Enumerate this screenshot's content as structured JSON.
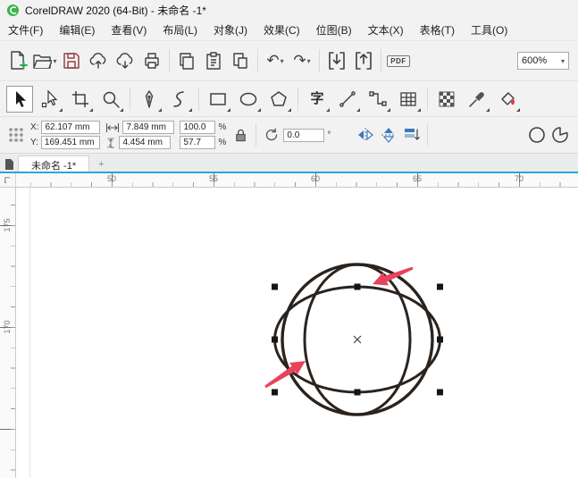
{
  "titlebar": {
    "title": "CorelDRAW 2020 (64-Bit) - 未命名 -1*"
  },
  "menubar": {
    "items": [
      "文件(F)",
      "编辑(E)",
      "查看(V)",
      "布局(L)",
      "对象(J)",
      "效果(C)",
      "位图(B)",
      "文本(X)",
      "表格(T)",
      "工具(O)"
    ]
  },
  "toolbar": {
    "pdf_label": "PDF",
    "zoom_value": "600%"
  },
  "toolbox": {
    "text_tool_glyph": "字"
  },
  "property_bar": {
    "x_label": "X:",
    "x_value": "62.107 mm",
    "y_label": "Y:",
    "y_value": "169.451 mm",
    "width_value": "7.849 mm",
    "height_value": "4.454 mm",
    "scale_h_value": "100.0",
    "scale_v_value": "57.7",
    "percent": "%",
    "rotation_value": "0.0",
    "degree_symbol": "°"
  },
  "tabbar": {
    "active_tab": "未命名 -1*",
    "new_tab_label": "+"
  },
  "rulers": {
    "h": [
      "50",
      "55",
      "60",
      "65",
      "70"
    ],
    "v": [
      "175",
      "170"
    ]
  },
  "glyphs": {
    "undo": "↶",
    "redo": "↷",
    "dropdown": "▾"
  },
  "colors": {
    "annotation_arrow_red": "#e8435a",
    "sphere_stroke": "#2a231e",
    "tab_underline_blue": "#2aa5dc",
    "logo_green": "#3cb54a"
  }
}
